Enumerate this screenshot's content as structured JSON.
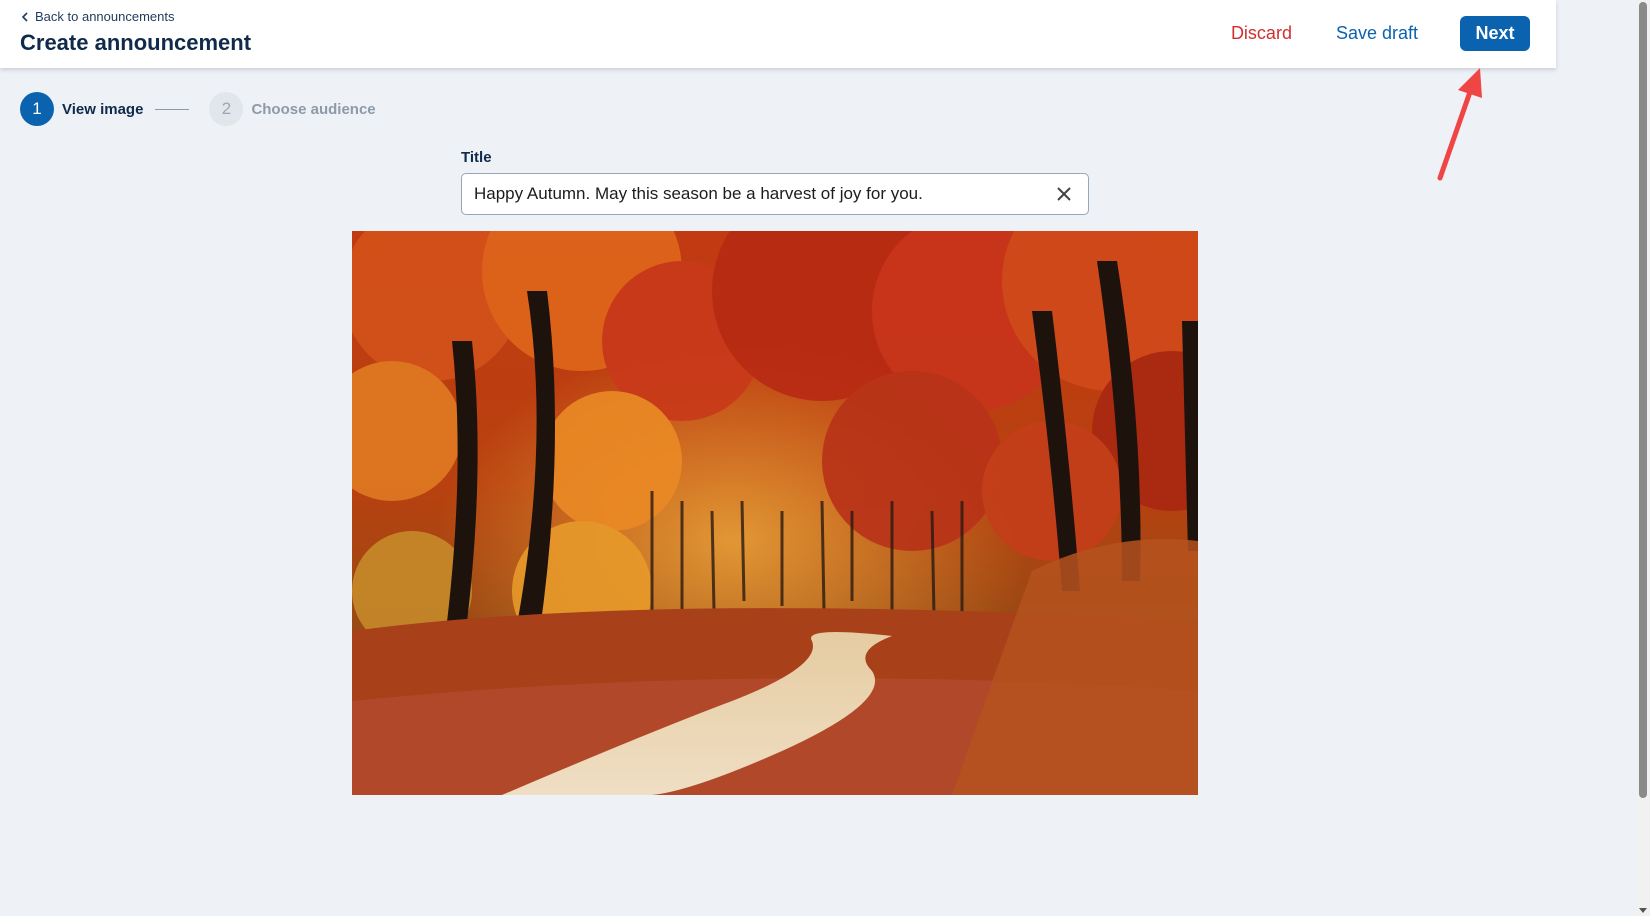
{
  "header": {
    "back_label": "Back to announcements",
    "title": "Create announcement",
    "discard_label": "Discard",
    "save_label": "Save draft",
    "next_label": "Next"
  },
  "stepper": {
    "steps": [
      {
        "number": "1",
        "label": "View image",
        "state": "active"
      },
      {
        "number": "2",
        "label": "Choose audience",
        "state": "inactive"
      }
    ]
  },
  "form": {
    "title_label": "Title",
    "title_value": "Happy Autumn. May this season be a harvest of joy for you."
  },
  "icons": {
    "back": "chevron-left-icon",
    "clear": "close-icon",
    "annotation": "red-arrow"
  },
  "colors": {
    "primary": "#0b63b0",
    "danger": "#d32f2f",
    "background": "#eef2f7",
    "annotation": "#f04545"
  }
}
